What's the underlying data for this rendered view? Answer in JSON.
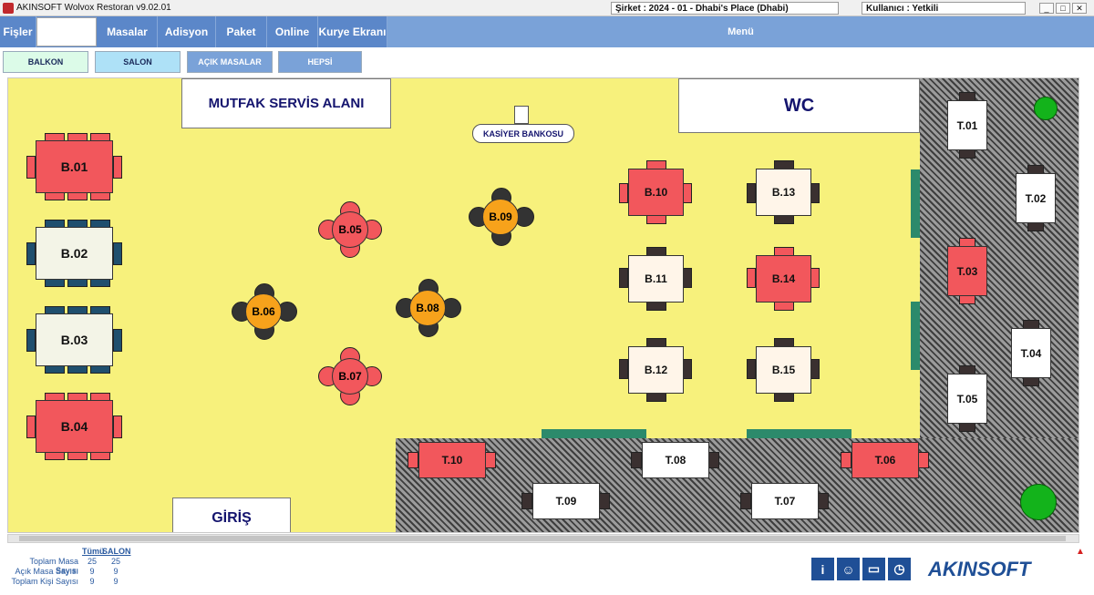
{
  "titlebar": {
    "app_title": "AKINSOFT Wolvox Restoran v9.02.01",
    "company": "Şirket : 2024 - 01 - Dhabi's Place (Dhabi)",
    "user": "Kullanıcı : Yetkili",
    "buttons": [
      "_",
      "□",
      "✕"
    ]
  },
  "menu": {
    "items": [
      "Fişler",
      "Masalar",
      "Adisyon",
      "Paket",
      "Online",
      "Kurye Ekranı"
    ],
    "title": "Menü"
  },
  "tabs": [
    "BALKON",
    "SALON",
    "AÇIK MASALAR",
    "HEPSİ"
  ],
  "floor": {
    "kitchen_label": "MUTFAK SERVİS ALANI",
    "wc_label": "WC",
    "cashier_label": "KASİYER BANKOSU",
    "entrance_label": "GİRİŞ"
  },
  "tables": {
    "B01": "B.01",
    "B02": "B.02",
    "B03": "B.03",
    "B04": "B.04",
    "B05": "B.05",
    "B06": "B.06",
    "B07": "B.07",
    "B08": "B.08",
    "B09": "B.09",
    "B10": "B.10",
    "B11": "B.11",
    "B12": "B.12",
    "B13": "B.13",
    "B14": "B.14",
    "B15": "B.15",
    "T01": "T.01",
    "T02": "T.02",
    "T03": "T.03",
    "T04": "T.04",
    "T05": "T.05",
    "T06": "T.06",
    "T07": "T.07",
    "T08": "T.08",
    "T09": "T.09",
    "T10": "T.10"
  },
  "stats": {
    "headers": [
      "Tümü",
      "SALON"
    ],
    "rows": [
      {
        "label": "Toplam Masa Sayısı",
        "all": "25",
        "salon": "25"
      },
      {
        "label": "Açık Masa Sayısı",
        "all": "9",
        "salon": "9"
      },
      {
        "label": "Toplam Kişi Sayısı",
        "all": "9",
        "salon": "9"
      }
    ]
  },
  "bottom_icons": [
    "info-icon",
    "users-icon",
    "payment-icon",
    "clock-icon"
  ],
  "logo": "AKINSOFT",
  "colors": {
    "occupied": "#f2575c",
    "reserved": "#f7a21b",
    "free": "#ffffff",
    "floor": "#f7f17c",
    "menubar": "#5b87c9"
  }
}
